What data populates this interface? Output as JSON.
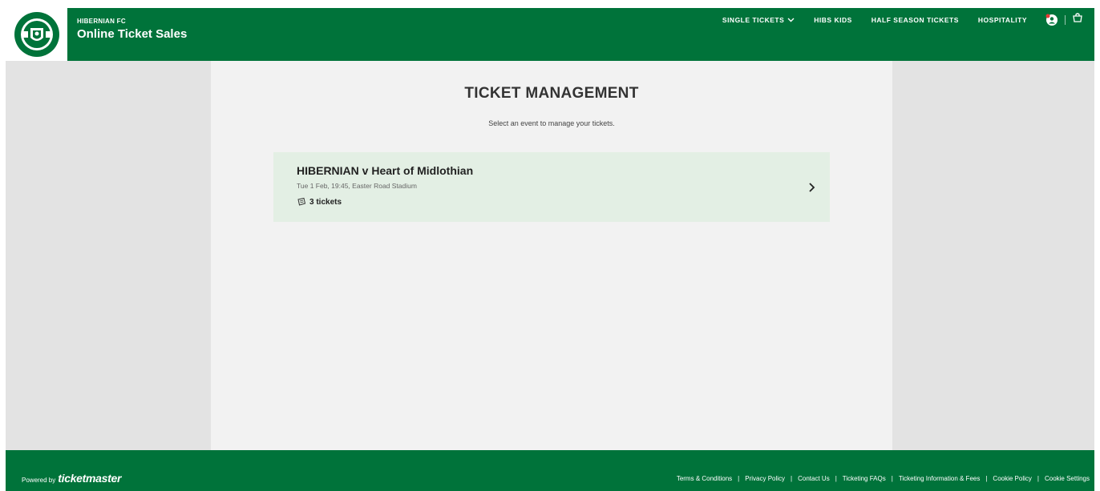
{
  "header": {
    "brand_small": "HIBERNIAN FC",
    "brand_title": "Online Ticket Sales",
    "nav": [
      {
        "label": "SINGLE TICKETS",
        "has_dropdown": true
      },
      {
        "label": "HIBS KIDS"
      },
      {
        "label": "HALF SEASON TICKETS"
      },
      {
        "label": "HOSPITALITY"
      }
    ],
    "icons": [
      "user-icon",
      "basket-icon"
    ]
  },
  "main": {
    "title": "TICKET MANAGEMENT",
    "subtitle": "Select an event to manage your tickets.",
    "events": [
      {
        "name": "HIBERNIAN v Heart of Midlothian",
        "details": "Tue 1 Feb, 19:45, Easter Road Stadium",
        "tickets": "3 tickets"
      }
    ]
  },
  "footer": {
    "powered_label": "Powered by",
    "brand": "ticketmaster",
    "links": [
      "Terms & Conditions",
      "Privacy Policy",
      "Contact Us",
      "Ticketing FAQs",
      "Ticketing Information & Fees",
      "Cookie Policy",
      "Cookie Settings"
    ],
    "separator": "|"
  },
  "colors": {
    "brand_green": "#00733a",
    "card_bg": "#e3efe4",
    "page_bg": "#e3e3e3",
    "content_bg": "#f2f2f2"
  }
}
